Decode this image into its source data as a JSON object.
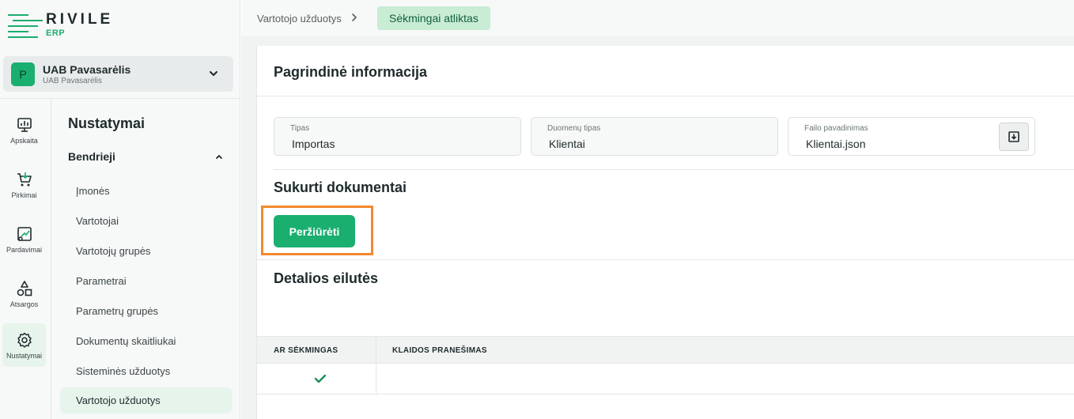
{
  "brand": {
    "name": "RIVILE",
    "sub": "ERP",
    "accent": "#1aae6f"
  },
  "company": {
    "avatar": "P",
    "name": "UAB Pavasarėlis",
    "sub": "UAB Pavasarėlis"
  },
  "rail": [
    {
      "label": "Apskaita",
      "icon": "chart-board-icon"
    },
    {
      "label": "Pirkimai",
      "icon": "cart-icon"
    },
    {
      "label": "Pardavimai",
      "icon": "sales-trend-icon"
    },
    {
      "label": "Atsargos",
      "icon": "shapes-icon"
    },
    {
      "label": "Nustatymai",
      "icon": "gear-icon",
      "active": true
    }
  ],
  "submenu": {
    "title": "Nustatymai",
    "group": "Bendrieji",
    "items": [
      "Įmonės",
      "Vartotojai",
      "Vartotojų grupės",
      "Parametrai",
      "Parametrų grupės",
      "Dokumentų skaitliukai",
      "Sisteminės užduotys",
      "Vartotojo užduotys"
    ],
    "active_index": 7
  },
  "breadcrumb": {
    "parent": "Vartotojo užduotys",
    "status": "Sėkmingai atliktas"
  },
  "main": {
    "section_title": "Pagrindinė informacija",
    "fields": [
      {
        "label": "Tipas",
        "value": "Importas"
      },
      {
        "label": "Duomenų tipas",
        "value": "Klientai"
      },
      {
        "label": "Failo pavadinimas",
        "value": "Klientai.json"
      }
    ],
    "created_docs_title": "Sukurti dokumentai",
    "view_button": "Peržiūrėti",
    "details_title": "Detalios eilutės",
    "table": {
      "headers": [
        "AR SĖKMINGAS",
        "KLAIDOS PRANEŠIMAS"
      ],
      "rows": [
        {
          "success": true,
          "error": ""
        }
      ]
    }
  }
}
